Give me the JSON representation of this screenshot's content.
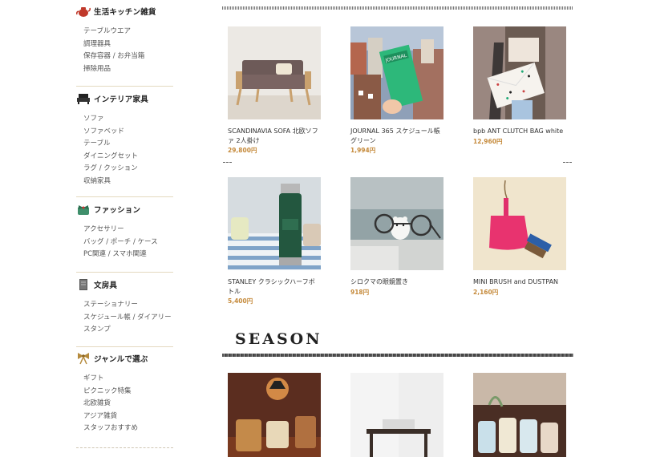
{
  "sidebar": {
    "categories": [
      {
        "title": "生活キッチン雑貨",
        "icon": "teapot-icon",
        "items": [
          "テーブルウエア",
          "調理器具",
          "保存容器 / お弁当箱",
          "掃除用品"
        ]
      },
      {
        "title": "インテリア家具",
        "icon": "armchair-icon",
        "items": [
          "ソファ",
          "ソファベッド",
          "テーブル",
          "ダイニングセット",
          "ラグ / クッション",
          "収納家具"
        ]
      },
      {
        "title": "ファッション",
        "icon": "ribbon-bag-icon",
        "items": [
          "アクセサリー",
          "バッグ / ポーチ / ケース",
          "PC関連 / スマホ関連"
        ]
      },
      {
        "title": "文房具",
        "icon": "notebook-icon",
        "items": [
          "ステーショナリー",
          "スケジュール帳 / ダイアリー",
          "スタンプ"
        ]
      },
      {
        "title": "ジャンルで選ぶ",
        "icon": "bow-icon",
        "items": [
          "ギフト",
          "ピクニック特集",
          "北欧雑貨",
          "アジア雑貨",
          "スタッフおすすめ"
        ]
      }
    ]
  },
  "products": [
    {
      "name": "SCANDINAVIA SOFA 北欧ソファ 2人掛け",
      "price": "29,800円",
      "image": "sofa-image"
    },
    {
      "name": "JOURNAL 365 スケジュール帳グリーン",
      "price": "1,994円",
      "image": "journal-image"
    },
    {
      "name": "bpb ANT CLUTCH BAG white",
      "price": "12,960円",
      "image": "clutch-image"
    },
    {
      "name": "STANLEY クラシックハーフボトル",
      "price": "5,400円",
      "image": "bottle-image"
    },
    {
      "name": "シロクマの眼鏡置き",
      "price": "918円",
      "image": "bear-image"
    },
    {
      "name": "MINI BRUSH and DUSTPAN",
      "price": "2,160円",
      "image": "dustpan-image"
    }
  ],
  "season": {
    "heading": "SEASON",
    "items": [
      {
        "image": "mugs-image"
      },
      {
        "image": "shelf-image"
      },
      {
        "image": "jars-image"
      }
    ]
  }
}
